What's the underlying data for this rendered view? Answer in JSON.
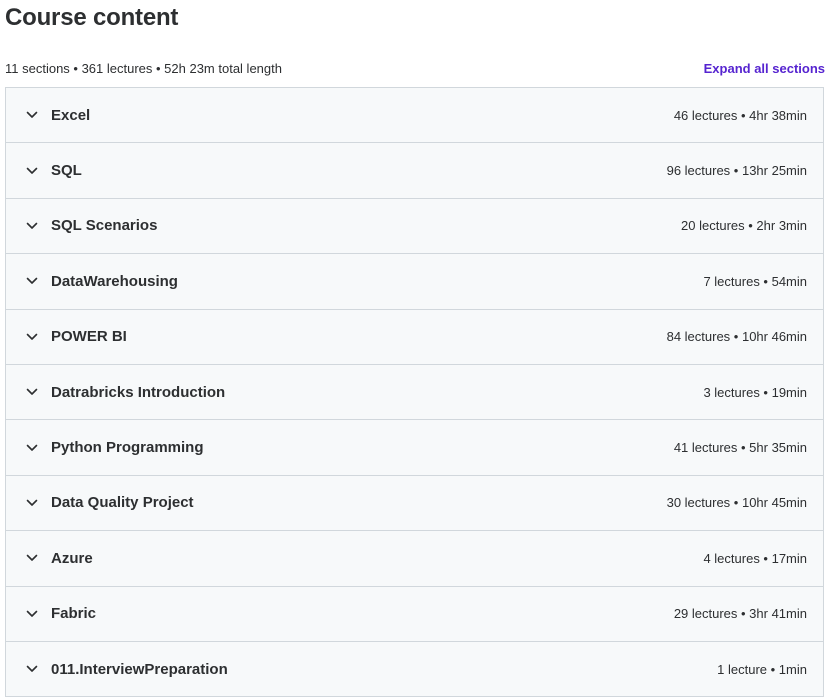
{
  "header": {
    "title": "Course content",
    "summary": "11 sections • 361 lectures • 52h 23m total length",
    "expand_label": "Expand all sections"
  },
  "icons": {
    "section_toggle": "chevron-down-icon"
  },
  "colors": {
    "accent": "#5624d0",
    "text": "#2d2f31",
    "row_bg": "#f7f9fa",
    "border": "#d1d7dc"
  },
  "sections": [
    {
      "title": "Excel",
      "meta": "46 lectures • 4hr 38min"
    },
    {
      "title": "SQL",
      "meta": "96 lectures • 13hr 25min"
    },
    {
      "title": "SQL Scenarios",
      "meta": "20 lectures • 2hr 3min"
    },
    {
      "title": "DataWarehousing",
      "meta": "7 lectures • 54min"
    },
    {
      "title": "POWER BI",
      "meta": "84 lectures • 10hr 46min"
    },
    {
      "title": "Datrabricks Introduction",
      "meta": "3 lectures • 19min"
    },
    {
      "title": "Python Programming",
      "meta": "41 lectures • 5hr 35min"
    },
    {
      "title": "Data Quality Project",
      "meta": "30 lectures • 10hr 45min"
    },
    {
      "title": "Azure",
      "meta": "4 lectures • 17min"
    },
    {
      "title": "Fabric",
      "meta": "29 lectures • 3hr 41min"
    },
    {
      "title": "011.InterviewPreparation",
      "meta": "1 lecture • 1min"
    }
  ]
}
